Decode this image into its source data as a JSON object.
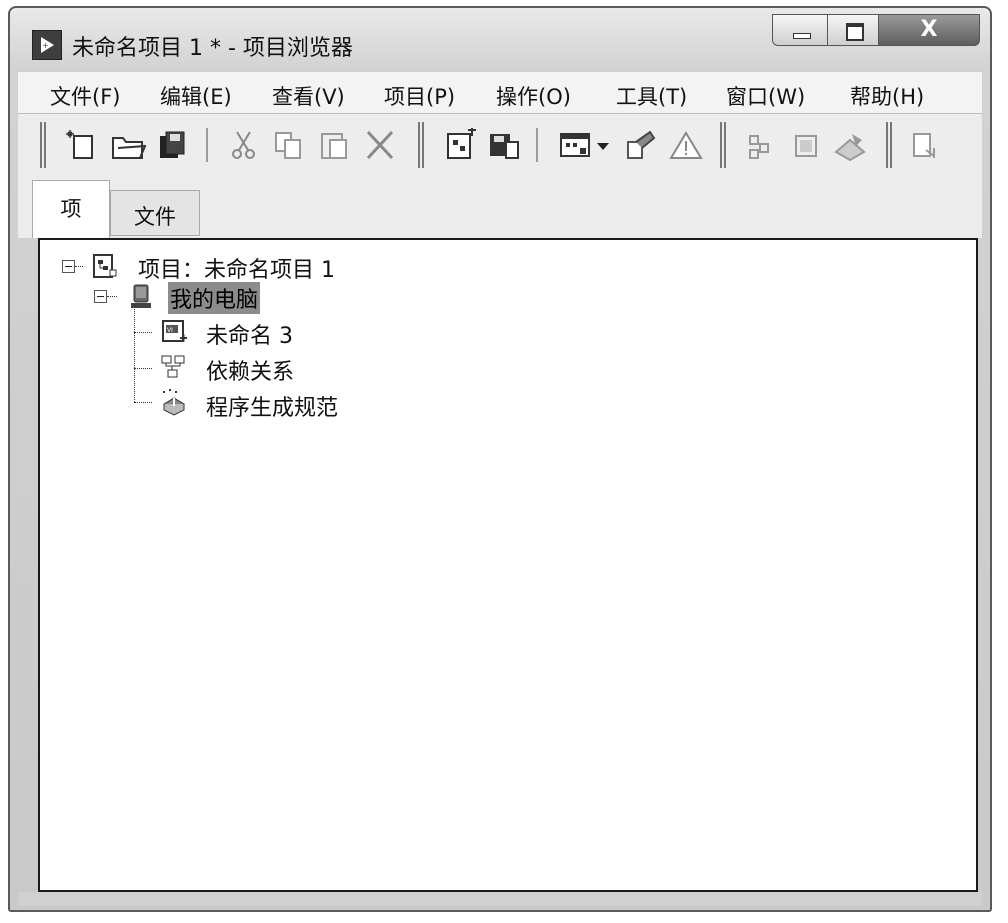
{
  "window": {
    "title": "未命名项目 1 * - 项目浏览器",
    "close_glyph": "X"
  },
  "menu": [
    {
      "label": "文件(F)"
    },
    {
      "label": "编辑(E)"
    },
    {
      "label": "查看(V)"
    },
    {
      "label": "项目(P)"
    },
    {
      "label": "操作(O)"
    },
    {
      "label": "工具(T)"
    },
    {
      "label": "窗口(W)"
    },
    {
      "label": "帮助(H)"
    }
  ],
  "toolbar": {
    "icons": [
      "new-file-icon",
      "open-folder-icon",
      "save-all-icon",
      "cut-icon",
      "copy-icon",
      "paste-icon",
      "delete-icon",
      "add-to-project-icon",
      "save-project-icon",
      "view-options-icon",
      "dropdown-arrow-icon",
      "properties-icon",
      "warning-icon",
      "build-icon",
      "deploy-icon",
      "run-icon",
      "more-icon"
    ]
  },
  "tabs": [
    {
      "label": "项",
      "active": true
    },
    {
      "label": "文件",
      "active": false
    }
  ],
  "tree": {
    "root": {
      "label": "项目：未命名项目 1",
      "icon": "project-icon"
    },
    "computer": {
      "label": "我的电脑",
      "icon": "computer-icon",
      "selected": true
    },
    "children": [
      {
        "label": "未命名 3",
        "icon": "vi-icon"
      },
      {
        "label": "依赖关系",
        "icon": "dependencies-icon"
      },
      {
        "label": "程序生成规范",
        "icon": "build-spec-icon"
      }
    ]
  },
  "colors": {
    "selection": "#8c8c8c",
    "panel_border": "#1a1a1a",
    "title_gradient_top": "#e9e9e9"
  }
}
